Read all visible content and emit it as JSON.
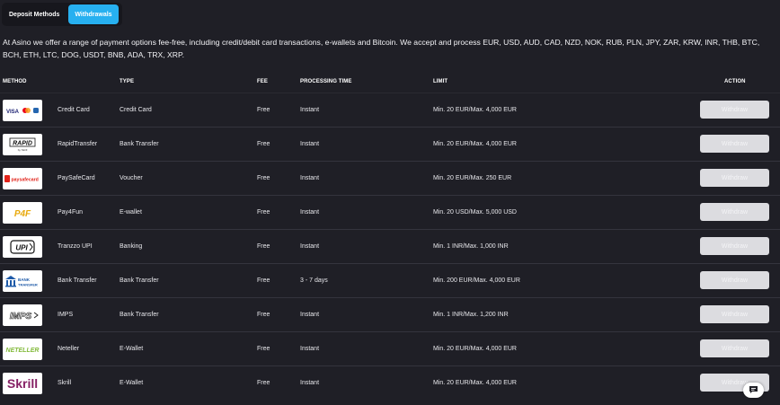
{
  "tabs": [
    {
      "label": "Deposit Methods",
      "active": false
    },
    {
      "label": "Withdrawals",
      "active": true
    }
  ],
  "intro": "At Asino we offer a range of payment options fee-free, including credit/debit card transactions, e-wallets and Bitcoin. We accept and process EUR, USD, AUD, CAD, NZD, NOK, RUB, PLN, JPY, ZAR, KRW, INR, THB, BTC, BCH, ETH, LTC, DOG, USDT, BNB, ADA, TRX, XRP.",
  "columns": {
    "method": "METHOD",
    "type": "TYPE",
    "fee": "FEE",
    "processing": "PROCESSING TIME",
    "limit": "LIMIT",
    "action": "ACTION"
  },
  "rows": [
    {
      "logo": "visa-mastercard-logo",
      "name": "Credit Card",
      "type": "Credit Card",
      "fee": "Free",
      "time": "Instant",
      "limit": "Min. 20 EUR/Max. 4,000 EUR",
      "action": "Withdraw"
    },
    {
      "logo": "rapid-transfer-logo",
      "name": "RapidTransfer",
      "type": "Bank Transfer",
      "fee": "Free",
      "time": "Instant",
      "limit": "Min. 20 EUR/Max. 4,000 EUR",
      "action": "Withdraw"
    },
    {
      "logo": "paysafecard-logo",
      "name": "PaySafeCard",
      "type": "Voucher",
      "fee": "Free",
      "time": "Instant",
      "limit": "Min. 20 EUR/Max. 250 EUR",
      "action": "Withdraw"
    },
    {
      "logo": "pay4fun-logo",
      "name": "Pay4Fun",
      "type": "E-wallet",
      "fee": "Free",
      "time": "Instant",
      "limit": "Min. 20 USD/Max. 5,000 USD",
      "action": "Withdraw"
    },
    {
      "logo": "upi-logo",
      "name": "Tranzzo UPI",
      "type": "Banking",
      "fee": "Free",
      "time": "Instant",
      "limit": "Min. 1 INR/Max. 1,000 INR",
      "action": "Withdraw"
    },
    {
      "logo": "bank-transfer-logo",
      "name": "Bank Transfer",
      "type": "Bank Transfer",
      "fee": "Free",
      "time": "3 - 7 days",
      "limit": "Min. 200 EUR/Max. 4,000 EUR",
      "action": "Withdraw"
    },
    {
      "logo": "imps-logo",
      "name": "IMPS",
      "type": "Bank Transfer",
      "fee": "Free",
      "time": "Instant",
      "limit": "Min. 1 INR/Max. 1,200 INR",
      "action": "Withdraw"
    },
    {
      "logo": "neteller-logo",
      "name": "Neteller",
      "type": "E-Wallet",
      "fee": "Free",
      "time": "Instant",
      "limit": "Min. 20 EUR/Max. 4,000 EUR",
      "action": "Withdraw"
    },
    {
      "logo": "skrill-logo",
      "name": "Skrill",
      "type": "E-Wallet",
      "fee": "Free",
      "time": "Instant",
      "limit": "Min. 20 EUR/Max. 4,000 EUR",
      "action": "Withdraw"
    }
  ],
  "logo_text": {
    "visa": "VISA",
    "rapid": "RAPID",
    "rapid_sub": "by Skrill",
    "paysafe": "paysafecard",
    "pay4fun": "P4F",
    "upi": "UPI",
    "bank": "BANK",
    "bank_sub": "TRANSFER",
    "imps": "IMPS",
    "neteller": "NETELLER",
    "skrill": "Skrill"
  },
  "chat_icon": "chat-bubble-icon",
  "colors": {
    "background": "#1f1f26",
    "accent": "#27b0f0",
    "button": "#dcdce0",
    "neteller_green": "#83ba3b",
    "skrill_purple": "#862165",
    "paysafe_red": "#e2231a"
  }
}
